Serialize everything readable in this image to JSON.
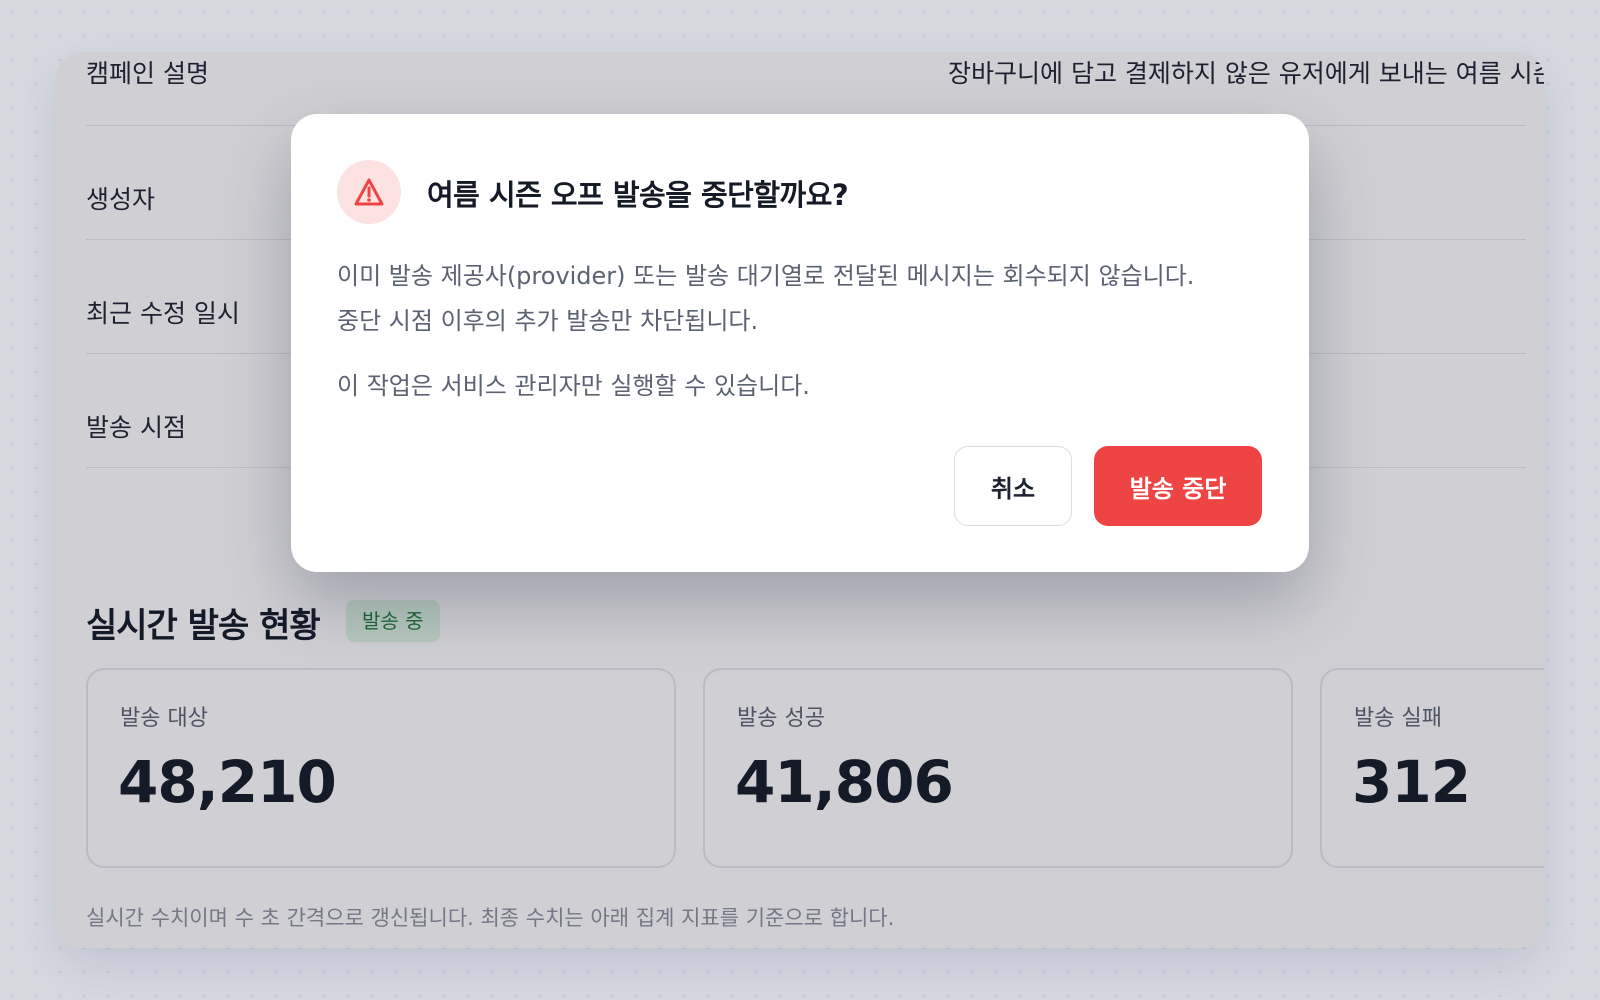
{
  "details": {
    "rows": [
      {
        "label": "캠페인 설명",
        "value": "장바구니에 담고 결제하지 않은 유저에게 보내는 여름 시즌 오"
      },
      {
        "label": "생성자",
        "value": ""
      },
      {
        "label": "최근 수정 일시",
        "value": ""
      },
      {
        "label": "발송 시점",
        "value": ""
      }
    ]
  },
  "live": {
    "title": "실시간 발송 현황",
    "badge": "발송 중",
    "stats": [
      {
        "label": "발송 대상",
        "value": "48,210"
      },
      {
        "label": "발송 성공",
        "value": "41,806"
      },
      {
        "label": "발송 실패",
        "value": "312"
      }
    ],
    "footnote": "실시간 수치이며 수 초 간격으로 갱신됩니다. 최종 수치는 아래 집계 지표를 기준으로 합니다."
  },
  "modal": {
    "icon": "warning-triangle-icon",
    "title": "여름 시즌 오프 발송을 중단할까요?",
    "body_line1": "이미 발송 제공사(provider) 또는 발송 대기열로 전달된 메시지는 회수되지 않습니다.",
    "body_line2": "중단 시점 이후의 추가 발송만 차단됩니다.",
    "note": "이 작업은 서비스 관리자만 실행할 수 있습니다.",
    "cancel_label": "취소",
    "confirm_label": "발송 중단"
  },
  "colors": {
    "danger": "#ef4444",
    "danger_soft": "#fde2e2",
    "success_badge_bg": "#dff5e3",
    "success_badge_text": "#1e7a3a"
  }
}
